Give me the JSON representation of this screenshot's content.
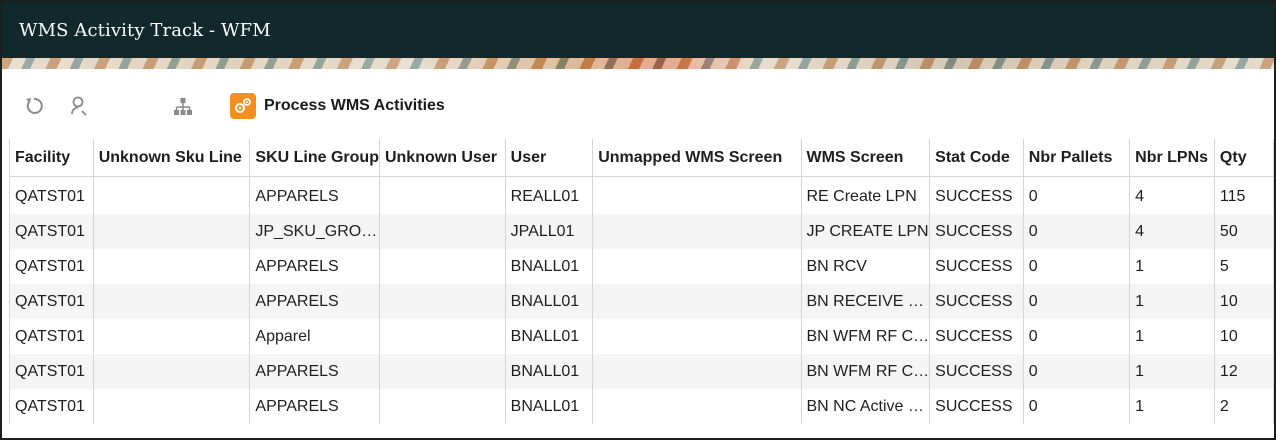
{
  "window": {
    "title": "WMS Activity Track - WFM"
  },
  "toolbar": {
    "refresh_icon": "refresh-icon",
    "search_icon": "person-search-icon",
    "hierarchy_icon": "hierarchy-icon",
    "process_label": "Process WMS Activities",
    "accent": "#f39021"
  },
  "table": {
    "columns": [
      "Facility",
      "Unknown Sku Line",
      "SKU Line Group",
      "Unknown User",
      "User",
      "Unmapped WMS Screen",
      "WMS Screen",
      "Stat Code",
      "Nbr Pallets",
      "Nbr LPNs",
      "Qty"
    ],
    "rows": [
      [
        "QATST01",
        "",
        "APPARELS",
        "",
        "REALL01",
        "",
        "RE Create LPN",
        "SUCCESS",
        "0",
        "4",
        "115"
      ],
      [
        "QATST01",
        "",
        "JP_SKU_GRO…",
        "",
        "JPALL01",
        "",
        "JP CREATE LPN",
        "SUCCESS",
        "0",
        "4",
        "50"
      ],
      [
        "QATST01",
        "",
        "APPARELS",
        "",
        "BNALL01",
        "",
        "BN RCV",
        "SUCCESS",
        "0",
        "1",
        "5"
      ],
      [
        "QATST01",
        "",
        "APPARELS",
        "",
        "BNALL01",
        "",
        "BN RECEIVE …",
        "SUCCESS",
        "0",
        "1",
        "10"
      ],
      [
        "QATST01",
        "",
        "Apparel",
        "",
        "BNALL01",
        "",
        "BN WFM RF C…",
        "SUCCESS",
        "0",
        "1",
        "10"
      ],
      [
        "QATST01",
        "",
        "APPARELS",
        "",
        "BNALL01",
        "",
        "BN WFM RF C…",
        "SUCCESS",
        "0",
        "1",
        "12"
      ],
      [
        "QATST01",
        "",
        "APPARELS",
        "",
        "BNALL01",
        "",
        "BN NC Active …",
        "SUCCESS",
        "0",
        "1",
        "2"
      ]
    ]
  }
}
